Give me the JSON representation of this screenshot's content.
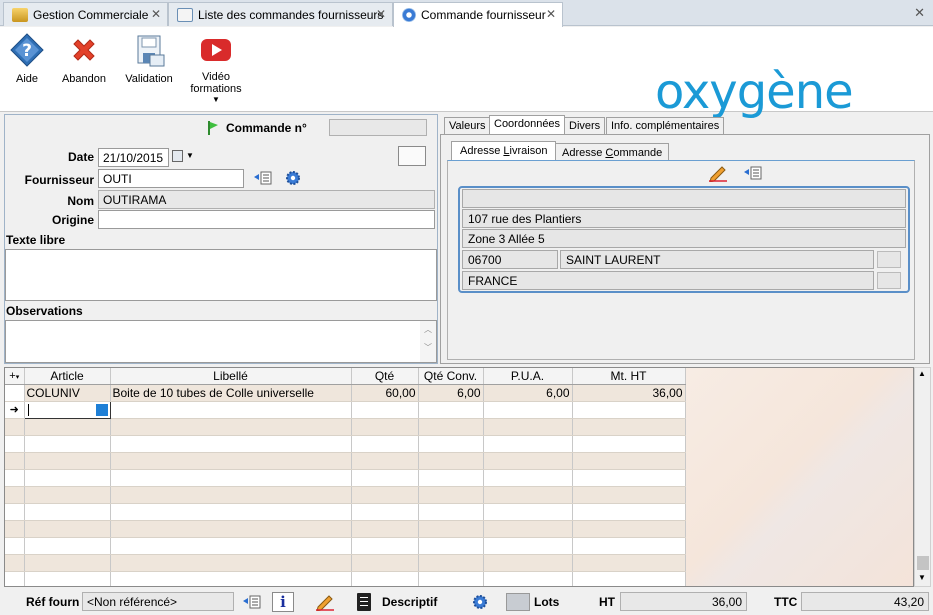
{
  "tabs": [
    {
      "label": "Gestion Commerciale",
      "close": "✕"
    },
    {
      "label": "Liste des commandes fournisseurs",
      "close": "✕"
    },
    {
      "label": "Commande fournisseur",
      "close": "✕"
    }
  ],
  "window_close": "✕",
  "toolbar": {
    "aide": "Aide",
    "abandon": "Abandon",
    "validation": "Validation",
    "video_line1": "Vidéo",
    "video_line2": "formations"
  },
  "logo_text": "oxygène",
  "header": {
    "commande_label": "Commande n°",
    "commande_value": ""
  },
  "form": {
    "date_label": "Date",
    "date_value": "21/10/2015",
    "fournisseur_label": "Fournisseur",
    "fournisseur_value": "OUTI",
    "nom_label": "Nom",
    "nom_value": "OUTIRAMA",
    "origine_label": "Origine",
    "origine_value": "",
    "texte_libre_label": "Texte libre",
    "texte_libre_value": "",
    "observations_label": "Observations",
    "observations_value": ""
  },
  "right_tabs": [
    "Valeurs",
    "Coordonnées",
    "Divers",
    "Info. complémentaires"
  ],
  "address_tabs": [
    {
      "prefix": "Adresse ",
      "ul": "L",
      "rest": "ivraison"
    },
    {
      "prefix": "Adresse ",
      "ul": "C",
      "rest": "ommande"
    }
  ],
  "address": {
    "line0": "",
    "line1": "107 rue des Plantiers",
    "line2": "Zone 3  Allée 5",
    "postcode": "06700",
    "city": "SAINT LAURENT",
    "country": "FRANCE"
  },
  "grid": {
    "columns": [
      "Article",
      "Libellé",
      "Qté",
      "Qté Conv.",
      "P.U.A.",
      "Mt. HT"
    ],
    "rows": [
      {
        "article": "COLUNIV",
        "libelle": "Boite de 10 tubes de Colle universelle",
        "qte": "60,00",
        "qte_conv": "6,00",
        "pua": "6,00",
        "mt_ht": "36,00"
      }
    ]
  },
  "footer": {
    "ref_fourn_label": "Réf fourn",
    "ref_fourn_value": "<Non référencé>",
    "descriptif": "Descriptif",
    "lots": "Lots",
    "ht_label": "HT",
    "ht_value": "36,00",
    "ttc_label": "TTC",
    "ttc_value": "43,20"
  },
  "colors": {
    "accent": "#1b9ad6",
    "row_alt": "#efe6dc",
    "abandon_red": "#e3412a",
    "youtube_red": "#d92b2b",
    "aide_blue": "#2f6fb5"
  }
}
